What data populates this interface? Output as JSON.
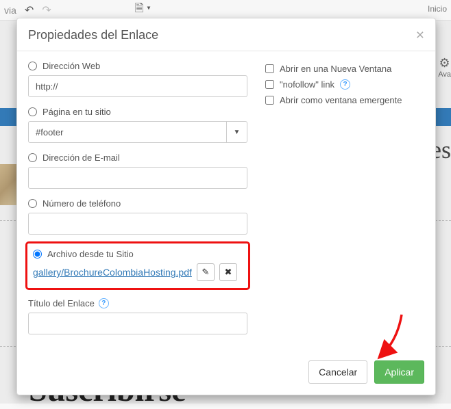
{
  "background": {
    "inicio": "Inicio",
    "via_text": "via",
    "ava_text": "Ava",
    "tes_fragment": "tes",
    "suscribirse": "Suscribirse"
  },
  "modal": {
    "title": "Propiedades del Enlace",
    "sections": {
      "web": {
        "label": "Dirección Web",
        "value": "http://"
      },
      "page": {
        "label": "Página en tu sitio",
        "value": "#footer"
      },
      "email": {
        "label": "Dirección de E-mail",
        "value": ""
      },
      "phone": {
        "label": "Número de teléfono",
        "value": ""
      },
      "file": {
        "label": "Archivo desde tu Sitio",
        "filename": "gallery/BrochureColombiaHosting.pdf"
      },
      "title": {
        "label": "Título del Enlace",
        "value": ""
      }
    },
    "options": {
      "new_window": "Abrir en una Nueva Ventana",
      "nofollow": "\"nofollow\" link",
      "popup": "Abrir como ventana emergente"
    },
    "buttons": {
      "cancel": "Cancelar",
      "apply": "Aplicar"
    }
  }
}
